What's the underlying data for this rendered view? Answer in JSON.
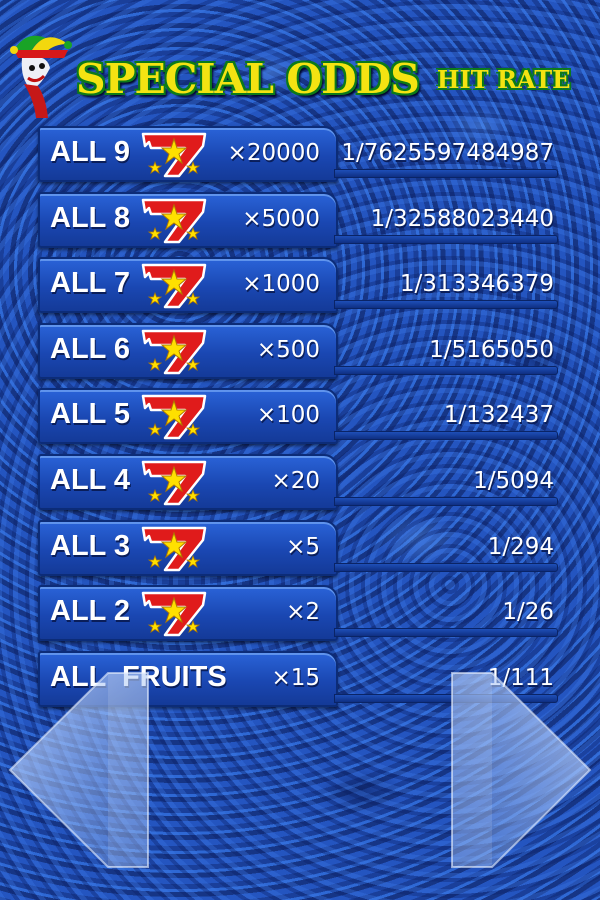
{
  "header": {
    "title": "SPECIAL ODDS",
    "subtitle": "HIT RATE"
  },
  "rows": [
    {
      "label": "ALL 9",
      "payout": "×20000",
      "odds": "1/7625597484987",
      "has_seven": true
    },
    {
      "label": "ALL 8",
      "payout": "×5000",
      "odds": "1/32588023440",
      "has_seven": true
    },
    {
      "label": "ALL 7",
      "payout": "×1000",
      "odds": "1/313346379",
      "has_seven": true
    },
    {
      "label": "ALL 6",
      "payout": "×500",
      "odds": "1/5165050",
      "has_seven": true
    },
    {
      "label": "ALL 5",
      "payout": "×100",
      "odds": "1/132437",
      "has_seven": true
    },
    {
      "label": "ALL 4",
      "payout": "×20",
      "odds": "1/5094",
      "has_seven": true
    },
    {
      "label": "ALL 3",
      "payout": "×5",
      "odds": "1/294",
      "has_seven": true
    },
    {
      "label": "ALL 2",
      "payout": "×2",
      "odds": "1/26",
      "has_seven": true
    },
    {
      "label": "ALL  FRUITS",
      "payout": "×15",
      "odds": "1/111",
      "has_seven": false
    }
  ],
  "icons": {
    "mascot": "jester-mascot-icon",
    "seven": "red-seven-star-icon",
    "prev": "left-arrow-icon",
    "next": "right-arrow-icon"
  },
  "colors": {
    "title_fill": "#f4e312",
    "title_outline": "#0c7a19",
    "seven_red": "#e01b1b",
    "star_yellow": "#ffe000",
    "background_blue": "#1a3f9a"
  }
}
